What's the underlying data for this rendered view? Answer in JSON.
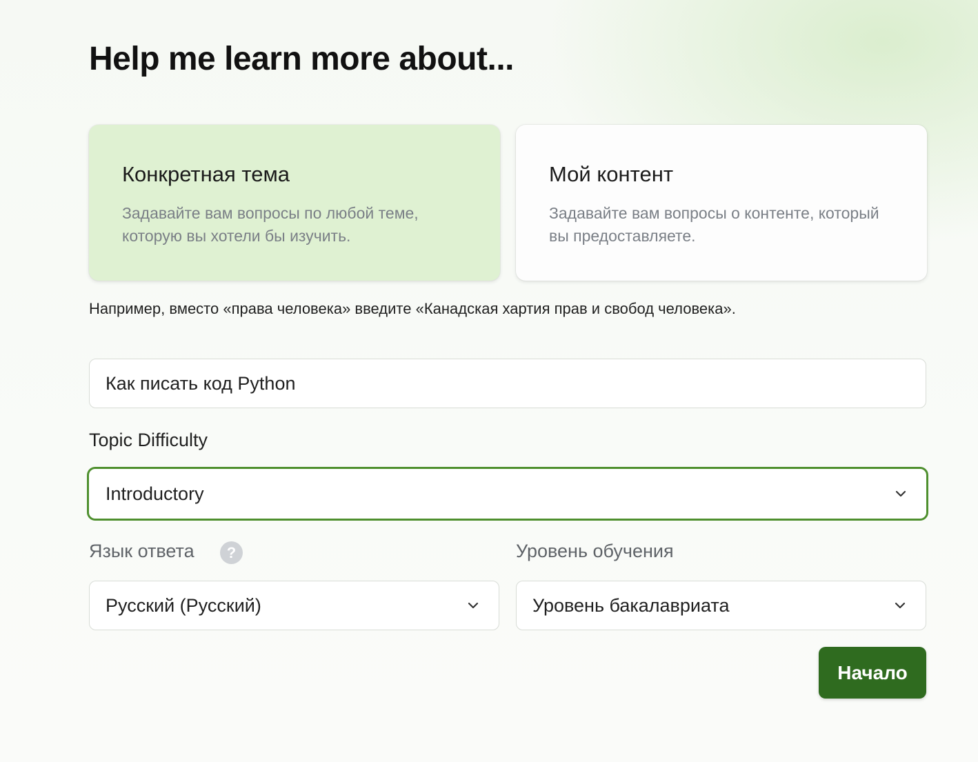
{
  "page": {
    "title": "Help me learn more about..."
  },
  "modes": [
    {
      "title": "Конкретная тема",
      "description": "Задавайте вам вопросы по любой теме, которую вы хотели бы изучить.",
      "selected": true
    },
    {
      "title": "Мой контент",
      "description": "Задавайте вам вопросы о контенте, который вы предоставляете.",
      "selected": false
    }
  ],
  "hint": "Например, вместо «права человека» введите «Канадская хартия прав и свобод человека».",
  "topic": {
    "value": "Как писать код Python"
  },
  "difficulty": {
    "label": "Topic Difficulty",
    "value": "Introductory"
  },
  "language": {
    "label": "Язык ответа",
    "help_glyph": "?",
    "value": "Русский (Русский)"
  },
  "education_level": {
    "label": "Уровень обучения",
    "value": "Уровень бакалавриата"
  },
  "actions": {
    "start_label": "Начало"
  },
  "colors": {
    "accent": "#2f6b1f",
    "selected_card": "#dff1d2",
    "focus_border": "#4e8f2e"
  },
  "icons": {
    "select_caret": "chevron-down-icon",
    "help": "question-circle-icon"
  }
}
